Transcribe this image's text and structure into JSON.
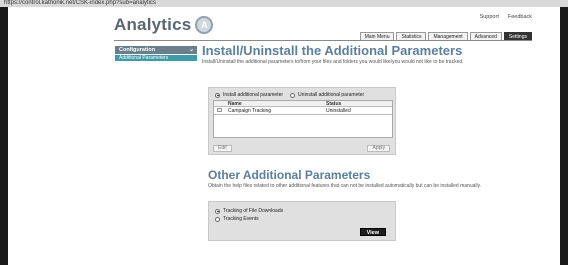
{
  "browser": {
    "url": "https://control.kathonik.net/CSK-index.php?sub=analytics"
  },
  "brand": {
    "name": "Analytics",
    "badge": "A"
  },
  "top_links": [
    "Support",
    "Feedback"
  ],
  "tabs": [
    {
      "label": "Main Menu"
    },
    {
      "label": "Statistics"
    },
    {
      "label": "Management"
    },
    {
      "label": "Advanced"
    },
    {
      "label": "Settings",
      "active": true
    }
  ],
  "sidebar": {
    "header": "Configuration",
    "items": [
      "Additional Parameters"
    ]
  },
  "section1": {
    "title": "Install/Uninstall the Additional Parameters",
    "description": "Install/Uninstall the additional parameters to/from your files and folders you would like/you would not like to be tracked.",
    "radio_install": "Install additional parameter",
    "radio_uninstall": "Uninstall additional parameter",
    "columns": [
      "Name",
      "Status"
    ],
    "rows": [
      {
        "name": "Campaign Tracking",
        "status": "Uninstalled"
      }
    ],
    "edit_label": "Edit",
    "apply_label": "Apply"
  },
  "section2": {
    "title": "Other Additional Parameters",
    "description": "Obtain the help files related to other additional features that can not be installed automatically but can be installed manually.",
    "options": [
      {
        "label": "Tracking of File Downloads",
        "selected": true
      },
      {
        "label": "Tracking Events",
        "selected": false
      }
    ],
    "view_label": "View"
  }
}
